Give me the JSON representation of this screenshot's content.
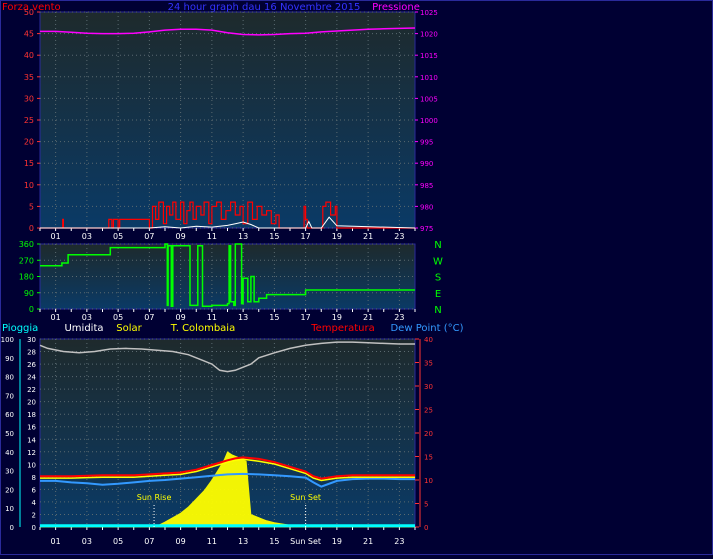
{
  "colors": {
    "background": "#000033",
    "frame": "#2a2a9a",
    "plot_bg_top": "#1e2a2c",
    "plot_bg_bottom": "#0a3a66",
    "grid": "#5a6a70",
    "wind": "#ff0000",
    "gust": "#ffffff",
    "pressure": "#ff00ff",
    "direction": "#00ff00",
    "rain": "#00ffff",
    "humidity": "#c0c0c0",
    "solar": "#ffff00",
    "temp_colombaia": "#ffff00",
    "temperature": "#ff0000",
    "dewpoint": "#3399ff",
    "text_tick": "#ffffff",
    "xtick": "#ffffff"
  },
  "chart_data": [
    {
      "type": "line",
      "title": "24 hour graph dau 16 Novembre 2015",
      "left_axis_label": "Forza vento",
      "right_axis_label": "Pressione",
      "xticks": [
        "01",
        "03",
        "05",
        "07",
        "09",
        "11",
        "13",
        "15",
        "17",
        "19",
        "21",
        "23"
      ],
      "yticks_left": [
        "0",
        "5",
        "10",
        "15",
        "20",
        "25",
        "30",
        "35",
        "40",
        "45",
        "50"
      ],
      "yticks_right": [
        "975",
        "980",
        "985",
        "990",
        "995",
        "1000",
        "1005",
        "1010",
        "1015",
        "1020",
        "1025"
      ],
      "ylim_left": [
        0,
        50
      ],
      "ylim_right": [
        975,
        1025
      ],
      "series": [
        {
          "role": "pressure",
          "x": [
            0,
            1,
            2,
            3,
            4,
            5,
            6,
            7,
            8,
            9,
            10,
            11,
            12,
            13,
            14,
            15,
            16,
            17,
            18,
            19,
            20,
            21,
            22,
            23,
            24
          ],
          "values": [
            1020.5,
            1020.5,
            1020.3,
            1020.1,
            1020.0,
            1020.0,
            1020.1,
            1020.4,
            1020.8,
            1021.0,
            1021.0,
            1020.8,
            1020.2,
            1019.8,
            1019.7,
            1019.8,
            1020.0,
            1020.1,
            1020.4,
            1020.6,
            1020.8,
            1021.0,
            1021.1,
            1021.2,
            1021.3
          ]
        },
        {
          "role": "wind",
          "x": [
            0,
            1.4,
            1.45,
            1.5,
            4.3,
            4.4,
            4.6,
            4.7,
            5.0,
            5.1,
            7.0,
            7.2,
            7.4,
            7.6,
            7.9,
            8.1,
            8.3,
            8.5,
            8.7,
            9.0,
            9.2,
            9.4,
            9.6,
            9.8,
            10.0,
            10.3,
            10.5,
            10.8,
            11.0,
            11.3,
            11.6,
            11.9,
            12.2,
            12.5,
            12.8,
            13.0,
            13.3,
            13.6,
            13.9,
            14.2,
            14.5,
            14.8,
            15.1,
            15.3,
            16.8,
            16.9,
            17.0,
            17.1,
            18.0,
            18.1,
            18.3,
            18.6,
            18.9,
            19.0,
            24
          ],
          "values": [
            0,
            0,
            2,
            0,
            0,
            2,
            0,
            2,
            0,
            2,
            0,
            5,
            2,
            6,
            1,
            5,
            3,
            6,
            2,
            6,
            1,
            4,
            6,
            2,
            5,
            3,
            6,
            1,
            5,
            6,
            2,
            4,
            6,
            3,
            5,
            1,
            6,
            2,
            5,
            3,
            4,
            1,
            3,
            0,
            0,
            5,
            2,
            0,
            0,
            5,
            6,
            3,
            5,
            0,
            0
          ]
        },
        {
          "role": "gust",
          "x": [
            0,
            7.0,
            8.0,
            9.0,
            10.0,
            11.0,
            12.0,
            12.5,
            13.0,
            13.5,
            14.0,
            17.0,
            17.2,
            17.4,
            18.0,
            18.5,
            19.0,
            24
          ],
          "values": [
            0,
            0,
            0.3,
            0,
            0.4,
            0.2,
            0.6,
            1.0,
            1.4,
            0.8,
            0,
            0,
            1.5,
            0,
            0,
            2.5,
            0.5,
            0
          ]
        }
      ]
    },
    {
      "type": "line",
      "title": "",
      "right_labels": [
        "N",
        "W",
        "S",
        "E",
        "N"
      ],
      "yticks_left": [
        "0",
        "90",
        "180",
        "270",
        "360"
      ],
      "xticks": [
        "01",
        "03",
        "05",
        "07",
        "09",
        "11",
        "13",
        "15",
        "17",
        "19",
        "21",
        "23"
      ],
      "ylim": [
        0,
        360
      ],
      "series": [
        {
          "role": "direction",
          "x": [
            0,
            1.4,
            1.4,
            1.8,
            1.8,
            4.5,
            4.5,
            8.0,
            8.0,
            8.15,
            8.15,
            8.2,
            8.2,
            8.4,
            8.4,
            8.5,
            8.5,
            9.6,
            9.6,
            10.1,
            10.1,
            10.4,
            10.4,
            11.0,
            11.0,
            12.0,
            12.0,
            12.1,
            12.1,
            12.2,
            12.2,
            12.4,
            12.4,
            12.5,
            12.5,
            12.9,
            12.9,
            13.0,
            13.0,
            13.3,
            13.3,
            13.5,
            13.5,
            13.7,
            13.7,
            14.0,
            14.0,
            14.5,
            14.5,
            17.0,
            17.0,
            24
          ],
          "values": [
            240,
            240,
            255,
            255,
            300,
            300,
            340,
            340,
            360,
            360,
            20,
            20,
            350,
            350,
            15,
            15,
            350,
            350,
            20,
            20,
            350,
            350,
            15,
            15,
            20,
            20,
            30,
            30,
            350,
            350,
            40,
            40,
            20,
            20,
            360,
            360,
            30,
            30,
            170,
            170,
            40,
            40,
            180,
            180,
            40,
            40,
            60,
            60,
            80,
            80,
            105,
            105
          ]
        }
      ]
    },
    {
      "type": "line",
      "labels_top": [
        "Pioggia",
        "Umidita",
        "Solar",
        "T. Colombaia",
        "Temperatura",
        "Dew Point (°C)"
      ],
      "yticks_pioggia": [
        "0",
        "10",
        "20",
        "30",
        "40",
        "50",
        "60",
        "70",
        "80",
        "90",
        "100"
      ],
      "yticks_umidita": [
        "0",
        "2",
        "4",
        "6",
        "8",
        "10",
        "12",
        "14",
        "16",
        "18",
        "20",
        "22",
        "24",
        "26",
        "28",
        "30"
      ],
      "yticks_temp": [
        "0",
        "5",
        "10",
        "15",
        "20",
        "25",
        "30",
        "35",
        "40"
      ],
      "ylim_umidita": [
        0,
        30
      ],
      "ylim_temp": [
        0,
        40
      ],
      "xticks": [
        "01",
        "03",
        "05",
        "07",
        "09",
        "11",
        "13",
        "15",
        "Sun Set",
        "19",
        "21",
        "23"
      ],
      "annotations": [
        {
          "text": "Sun Rise",
          "x": 7.3
        },
        {
          "text": "Sun Set",
          "x": 17.0
        }
      ],
      "series": [
        {
          "role": "humidity",
          "x": [
            0,
            0.5,
            1.5,
            2.5,
            3.5,
            4.5,
            5.5,
            6.5,
            7.5,
            8.5,
            9.5,
            10.5,
            11.0,
            11.5,
            12.0,
            12.5,
            13.0,
            13.5,
            14.0,
            15.0,
            16.0,
            17.0,
            18.0,
            19.0,
            20.0,
            21.0,
            22.0,
            23.0,
            24
          ],
          "values": [
            29.0,
            28.5,
            28.0,
            27.8,
            28.0,
            28.4,
            28.5,
            28.4,
            28.2,
            28.0,
            27.5,
            26.5,
            26.0,
            25.0,
            24.8,
            25.0,
            25.5,
            26.0,
            27.0,
            27.8,
            28.5,
            29.0,
            29.3,
            29.5,
            29.5,
            29.4,
            29.3,
            29.2,
            29.2
          ]
        },
        {
          "role": "temperature",
          "x": [
            0,
            1,
            2,
            3,
            4,
            5,
            6,
            7,
            8,
            9,
            10,
            11,
            12,
            12.5,
            13,
            14,
            15,
            16,
            17,
            17.5,
            18,
            19,
            20,
            21,
            22,
            23,
            24
          ],
          "values": [
            10.8,
            10.8,
            10.8,
            10.9,
            11.0,
            11.0,
            11.0,
            11.2,
            11.4,
            11.6,
            12.2,
            13.2,
            14.2,
            14.6,
            14.8,
            14.5,
            13.8,
            12.8,
            11.8,
            10.8,
            10.3,
            10.8,
            11.0,
            11.0,
            11.0,
            11.0,
            11.0
          ]
        },
        {
          "role": "temp_colombaia",
          "x": [
            0,
            1,
            2,
            3,
            4,
            5,
            6,
            7,
            8,
            9,
            10,
            11,
            12,
            12.5,
            13,
            14,
            15,
            16,
            17,
            17.5,
            18,
            19,
            20,
            21,
            22,
            23,
            24
          ],
          "values": [
            10.4,
            10.4,
            10.4,
            10.5,
            10.6,
            10.6,
            10.6,
            10.8,
            11.0,
            11.2,
            11.8,
            12.8,
            13.8,
            14.2,
            14.4,
            14.0,
            13.4,
            12.4,
            11.4,
            10.4,
            9.9,
            10.4,
            10.6,
            10.6,
            10.6,
            10.6,
            10.6
          ]
        },
        {
          "role": "dewpoint",
          "x": [
            0,
            1,
            2,
            3,
            4,
            5,
            6,
            7,
            8,
            9,
            10,
            11,
            12,
            13,
            14,
            15,
            16,
            17,
            17.5,
            18,
            19,
            20,
            21,
            22,
            23,
            24
          ],
          "values": [
            9.8,
            9.8,
            9.5,
            9.3,
            9.0,
            9.2,
            9.5,
            9.8,
            10.0,
            10.3,
            10.6,
            10.9,
            11.2,
            11.3,
            11.2,
            11.0,
            10.8,
            10.5,
            9.5,
            8.6,
            9.8,
            10.2,
            10.3,
            10.3,
            10.2,
            10.2
          ]
        },
        {
          "role": "solar",
          "x": [
            0,
            7.3,
            7.6,
            8.0,
            8.5,
            9.0,
            9.5,
            10.0,
            10.5,
            11.0,
            11.5,
            11.8,
            12.0,
            12.3,
            12.8,
            13.2,
            13.5,
            14.0,
            14.5,
            15.0,
            15.5,
            16.0,
            16.5,
            17.0,
            24
          ],
          "values": [
            0,
            0,
            0.3,
            0.8,
            1.5,
            2.2,
            3.2,
            4.5,
            5.8,
            7.5,
            9.5,
            10.8,
            12.0,
            11.5,
            11.0,
            10.5,
            2.0,
            1.5,
            1.0,
            0.7,
            0.5,
            0.3,
            0.1,
            0,
            0
          ]
        },
        {
          "role": "rain",
          "x": [
            0,
            24
          ],
          "values": [
            0.2,
            0.2
          ]
        }
      ]
    }
  ]
}
